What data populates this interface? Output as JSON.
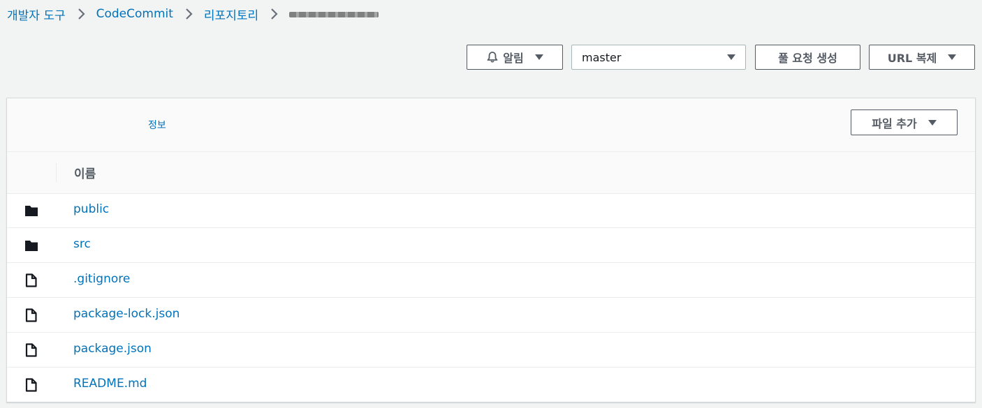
{
  "breadcrumb": {
    "items": [
      "개발자 도구",
      "CodeCommit",
      "리포지토리"
    ],
    "current": "repository-name (redacted)"
  },
  "toolbar": {
    "notify_label": "알림",
    "branch_value": "master",
    "pull_request_label": "풀 요청 생성",
    "clone_url_label": "URL 복제"
  },
  "panel": {
    "info_label": "정보",
    "add_file_label": "파일 추가",
    "column_name": "이름",
    "files": [
      {
        "name": "public",
        "type": "folder"
      },
      {
        "name": "src",
        "type": "folder"
      },
      {
        "name": ".gitignore",
        "type": "file"
      },
      {
        "name": "package-lock.json",
        "type": "file"
      },
      {
        "name": "package.json",
        "type": "file"
      },
      {
        "name": "README.md",
        "type": "file"
      }
    ]
  },
  "colors": {
    "link": "#0073bb",
    "page_bg": "#f2f3f3",
    "button_border": "#545b64"
  },
  "icons": [
    "chevron-right-icon",
    "bell-icon",
    "caret-down-icon",
    "folder-icon",
    "file-icon"
  ]
}
